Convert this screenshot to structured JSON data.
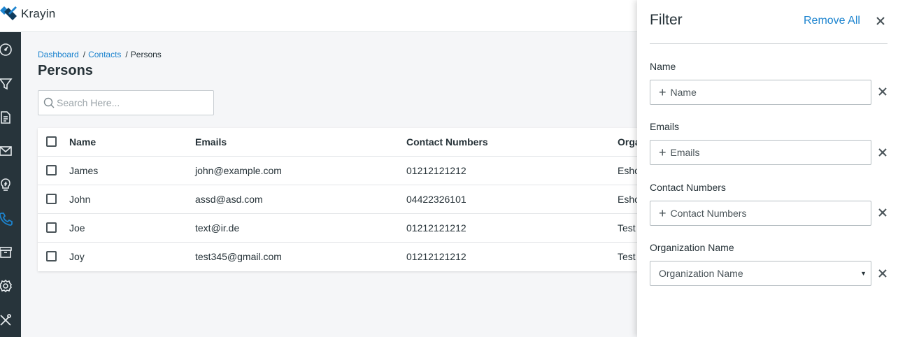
{
  "app": {
    "name": "Krayin"
  },
  "colors": {
    "accent": "#1d84cf",
    "sidebar": "#27343b",
    "icon": "#e6ebee",
    "active_icon": "#1d84cf"
  },
  "sidebar": {
    "items": [
      {
        "icon": "dashboard-gauge-icon"
      },
      {
        "icon": "filter-funnel-icon"
      },
      {
        "icon": "document-icon"
      },
      {
        "icon": "mail-icon"
      },
      {
        "icon": "lightbulb-icon"
      },
      {
        "icon": "phone-icon",
        "active": true
      },
      {
        "icon": "archive-box-icon"
      },
      {
        "icon": "settings-gear-icon"
      },
      {
        "icon": "tools-icon"
      }
    ]
  },
  "breadcrumb": {
    "items": [
      "Dashboard",
      "Contacts",
      "Persons"
    ],
    "separator": "/"
  },
  "page": {
    "title": "Persons"
  },
  "search": {
    "placeholder": "Search Here..."
  },
  "table": {
    "columns": [
      "Name",
      "Emails",
      "Contact Numbers",
      "Orga"
    ],
    "rows": [
      [
        "James",
        "john@example.com",
        "01212121212",
        "Esho"
      ],
      [
        "John",
        "assd@asd.com",
        "04422326101",
        "Esho"
      ],
      [
        "Joe",
        "text@ir.de",
        "01212121212",
        "Test"
      ],
      [
        "Joy",
        "test345@gmail.com",
        "01212121212",
        "Test"
      ]
    ]
  },
  "filter": {
    "title": "Filter",
    "remove_all": "Remove All",
    "fields": [
      {
        "label": "Name",
        "placeholder": "Name",
        "type": "add"
      },
      {
        "label": "Emails",
        "placeholder": "Emails",
        "type": "add"
      },
      {
        "label": "Contact Numbers",
        "placeholder": "Contact Numbers",
        "type": "add"
      },
      {
        "label": "Organization Name",
        "placeholder": "Organization Name",
        "type": "select"
      }
    ]
  }
}
